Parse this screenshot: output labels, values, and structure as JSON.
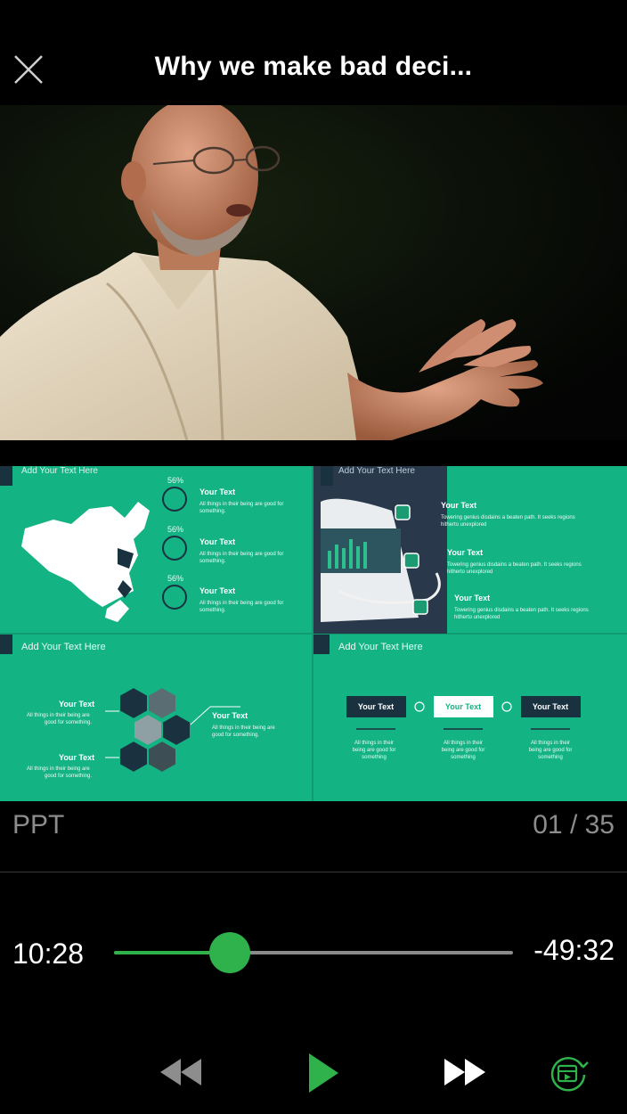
{
  "header": {
    "title": "Why we make bad deci...",
    "close_icon": "close-icon"
  },
  "slides": {
    "panel1": {
      "title": "Add Your Text Here",
      "items": [
        {
          "percent": "56%",
          "heading": "Your Text",
          "body1": "All things in their being are good for",
          "body2": "something."
        },
        {
          "percent": "56%",
          "heading": "Your Text",
          "body1": "All things in their being are good for",
          "body2": "something."
        },
        {
          "percent": "56%",
          "heading": "Your Text",
          "body1": "All things in their being are good for",
          "body2": "something."
        }
      ]
    },
    "panel2": {
      "title": "Add Your Text Here",
      "items": [
        {
          "heading": "Your Text",
          "body1": "Towering genius disdains a beaten path. It seeks regions",
          "body2": "hitherto unexplored"
        },
        {
          "heading": "Your Text",
          "body1": "Towering genius disdains a beaten path. It seeks regions",
          "body2": "hitherto unexplored"
        },
        {
          "heading": "Your Text",
          "body1": "Towering genius disdains a beaten path. It seeks regions",
          "body2": "hitherto unexplored"
        }
      ]
    },
    "panel3": {
      "title": "Add Your Text Here",
      "items": [
        {
          "heading": "Your Text",
          "body1": "All things in their being are",
          "body2": "good for something."
        },
        {
          "heading": "Your Text",
          "body1": "All things in their being are",
          "body2": "good for something."
        },
        {
          "heading": "Your Text",
          "body1": "All things in their being are",
          "body2": "good for something."
        }
      ]
    },
    "panel4": {
      "title": "Add Your Text Here",
      "boxes": [
        "Your Text",
        "Your Text",
        "Your Text"
      ],
      "captions": [
        {
          "l1": "All things in their",
          "l2": "being are good for",
          "l3": "something"
        },
        {
          "l1": "All things in their",
          "l2": "being are good for",
          "l3": "something"
        },
        {
          "l1": "All things in their",
          "l2": "being are good for",
          "l3": "something"
        }
      ]
    }
  },
  "ppt": {
    "label": "PPT",
    "page_counter": "01 / 35"
  },
  "player": {
    "elapsed": "10:28",
    "remaining": "-49:32",
    "progress": 0.29,
    "accent": "#2fb14c",
    "controls": {
      "rewind_icon": "rewind-icon",
      "play_icon": "play-icon",
      "fast_forward_icon": "fast-forward-icon",
      "cast_icon": "picture-in-picture-icon"
    }
  }
}
